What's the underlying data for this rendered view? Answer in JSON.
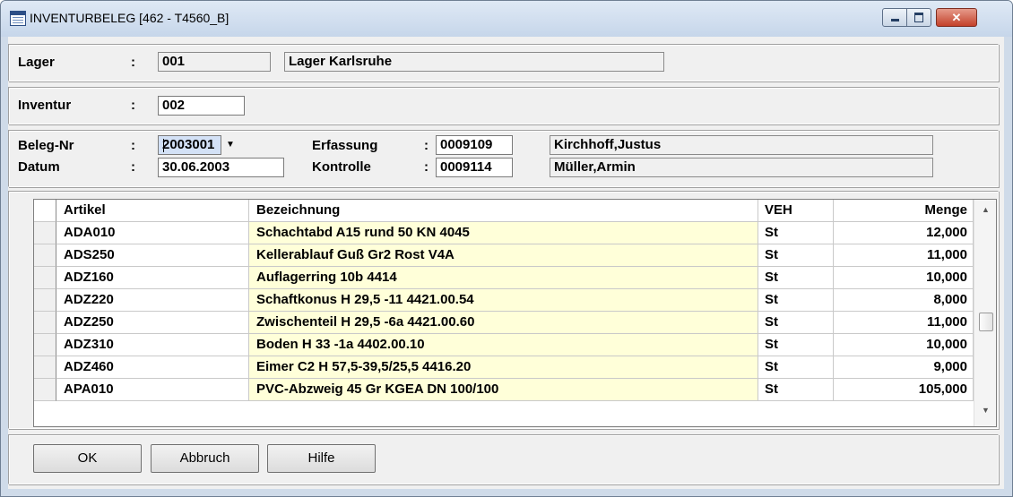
{
  "window": {
    "title": "INVENTURBELEG  [462 - T4560_B]"
  },
  "lager": {
    "label": "Lager",
    "colon": ":",
    "code": "001",
    "name": "Lager Karlsruhe"
  },
  "inventur": {
    "label": "Inventur",
    "colon": ":",
    "value": "002"
  },
  "beleg": {
    "nr_label": "Beleg-Nr",
    "colon": ":",
    "nr_value": "2003001",
    "datum_label": "Datum",
    "datum_value": "30.06.2003",
    "erfassung_label": "Erfassung",
    "erfassung_code": "0009109",
    "erfassung_name": "Kirchhoff,Justus",
    "kontrolle_label": "Kontrolle",
    "kontrolle_code": "0009114",
    "kontrolle_name": "Müller,Armin"
  },
  "table": {
    "columns": [
      "Artikel",
      "Bezeichnung",
      "VEH",
      "Menge"
    ],
    "rows": [
      {
        "artikel": "ADA010",
        "bezeichnung": "Schachtabd A15 rund 50 KN 4045",
        "veh": "St",
        "menge": "12,000"
      },
      {
        "artikel": "ADS250",
        "bezeichnung": "Kellerablauf Guß Gr2 Rost V4A",
        "veh": "St",
        "menge": "11,000"
      },
      {
        "artikel": "ADZ160",
        "bezeichnung": "Auflagerring 10b  4414",
        "veh": "St",
        "menge": "10,000"
      },
      {
        "artikel": "ADZ220",
        "bezeichnung": "Schaftkonus H 29,5 -11 4421.00.54",
        "veh": "St",
        "menge": "8,000"
      },
      {
        "artikel": "ADZ250",
        "bezeichnung": "Zwischenteil H 29,5 -6a 4421.00.60",
        "veh": "St",
        "menge": "11,000"
      },
      {
        "artikel": "ADZ310",
        "bezeichnung": "Boden H 33 -1a 4402.00.10",
        "veh": "St",
        "menge": "10,000"
      },
      {
        "artikel": "ADZ460",
        "bezeichnung": "Eimer C2 H 57,5-39,5/25,5 4416.20",
        "veh": "St",
        "menge": "9,000"
      },
      {
        "artikel": "APA010",
        "bezeichnung": "PVC-Abzweig 45 Gr KGEA DN 100/100",
        "veh": "St",
        "menge": "105,000"
      }
    ]
  },
  "buttons": {
    "ok": "OK",
    "abbruch": "Abbruch",
    "hilfe": "Hilfe"
  },
  "icons": {
    "title": "table-icon",
    "dropdown": "dropdown-arrow-icon",
    "scroll_up": "scroll-up-arrow-icon",
    "scroll_down": "scroll-down-arrow-icon"
  }
}
